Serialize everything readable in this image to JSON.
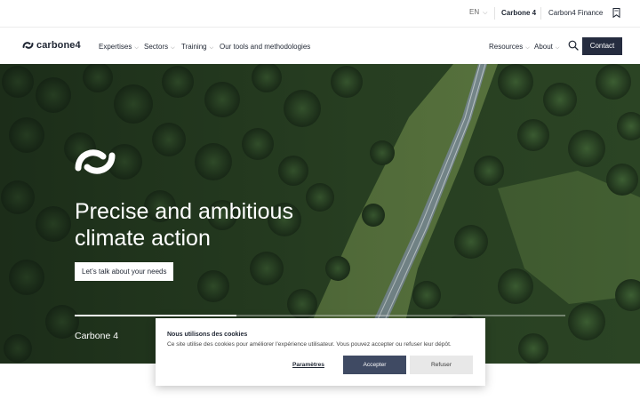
{
  "topbar": {
    "language": "EN",
    "links": [
      "Carbone 4",
      "Carbon4 Finance"
    ],
    "icon": "bookmark-icon"
  },
  "nav": {
    "logo_text": "carbone4",
    "items": [
      {
        "label": "Expertises",
        "dropdown": true
      },
      {
        "label": "Sectors",
        "dropdown": true
      },
      {
        "label": "Training",
        "dropdown": true
      },
      {
        "label": "Our tools and methodologies",
        "dropdown": false
      },
      {
        "label": "Resources",
        "dropdown": true
      },
      {
        "label": "About",
        "dropdown": true
      }
    ],
    "search_icon": "search-icon",
    "contact_label": "Contact"
  },
  "hero": {
    "title_line1": "Precise and ambitious",
    "title_line2": "climate action",
    "cta_label": "Let’s talk about your needs",
    "slide_label": "Carbone 4",
    "slide_progress": 0.33
  },
  "cookie": {
    "title": "Nous utilisons des cookies",
    "text": "Ce site utilise des cookies pour améliorer l'expérience utilisateur. Vous pouvez accepter ou refuser leur dépôt.",
    "params_label": "Paramètres",
    "accept_label": "Accepter",
    "refuse_label": "Refuser"
  },
  "colors": {
    "brand_dark": "#252c3f",
    "accept_button": "#3f4a63",
    "refuse_button": "#e8e8e8"
  }
}
